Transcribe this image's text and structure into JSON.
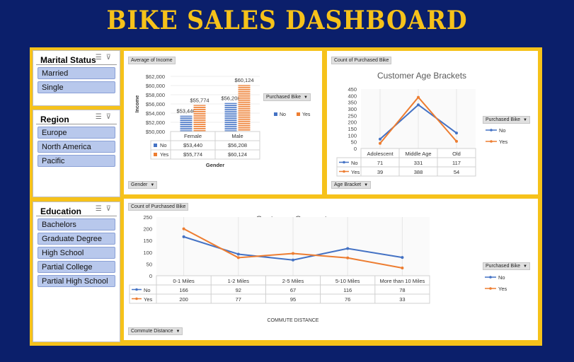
{
  "title": "BIKE SALES DASHBOARD",
  "slicers": {
    "marital": {
      "title": "Marital Status",
      "items": [
        "Married",
        "Single"
      ]
    },
    "region": {
      "title": "Region",
      "items": [
        "Europe",
        "North America",
        "Pacific"
      ]
    },
    "education": {
      "title": "Education",
      "items": [
        "Bachelors",
        "Graduate Degree",
        "High School",
        "Partial College",
        "Partial High School"
      ]
    }
  },
  "panels": {
    "income": {
      "value_field": "Average of Income",
      "legend_field": "Purchased Bike",
      "axis_field": "Gender",
      "legend_no": "No",
      "legend_yes": "Yes"
    },
    "age": {
      "value_field": "Count of Purchased Bike",
      "legend_field": "Purchased Bike",
      "axis_field": "Age Bracket",
      "legend_no": "No",
      "legend_yes": "Yes"
    },
    "commute": {
      "value_field": "Count of Purchased Bike",
      "legend_field": "Purchased Bike",
      "axis_field": "Commute Distance",
      "legend_no": "No",
      "legend_yes": "Yes"
    }
  },
  "colors": {
    "no": "#4472c4",
    "yes": "#ed7d31"
  },
  "chart_data": [
    {
      "type": "bar",
      "title": "",
      "categories": [
        "Female",
        "Male"
      ],
      "series": [
        {
          "name": "No",
          "values": [
            53440,
            56208
          ],
          "labels": [
            "$53,440",
            "$56,208"
          ]
        },
        {
          "name": "Yes",
          "values": [
            55774,
            60124
          ],
          "labels": [
            "$55,774",
            "$60,124"
          ]
        }
      ],
      "yticks": [
        "$50,000",
        "$52,000",
        "$54,000",
        "$56,000",
        "$58,000",
        "$60,000",
        "$62,000"
      ],
      "ylim": [
        50000,
        62000
      ],
      "ylabel": "Income",
      "xlabel": "Gender"
    },
    {
      "type": "line",
      "title": "Customer Age Brackets",
      "categories": [
        "Adolescent",
        "Middle Age",
        "Old"
      ],
      "series": [
        {
          "name": "No",
          "values": [
            71,
            331,
            117
          ]
        },
        {
          "name": "Yes",
          "values": [
            39,
            388,
            54
          ]
        }
      ],
      "yticks": [
        "0",
        "50",
        "100",
        "150",
        "200",
        "250",
        "300",
        "350",
        "400",
        "450"
      ],
      "ylim": [
        0,
        450
      ]
    },
    {
      "type": "line",
      "title": "Customer Commute",
      "categories": [
        "0-1 Miles",
        "1-2 Miles",
        "2-5 Miles",
        "5-10 Miles",
        "More than 10 Miles"
      ],
      "series": [
        {
          "name": "No",
          "values": [
            166,
            92,
            67,
            116,
            78
          ]
        },
        {
          "name": "Yes",
          "values": [
            200,
            77,
            95,
            76,
            33
          ]
        }
      ],
      "yticks": [
        "0",
        "50",
        "100",
        "150",
        "200",
        "250"
      ],
      "ylim": [
        0,
        250
      ],
      "xlabel": "COMMUTE DISTANCE"
    }
  ]
}
